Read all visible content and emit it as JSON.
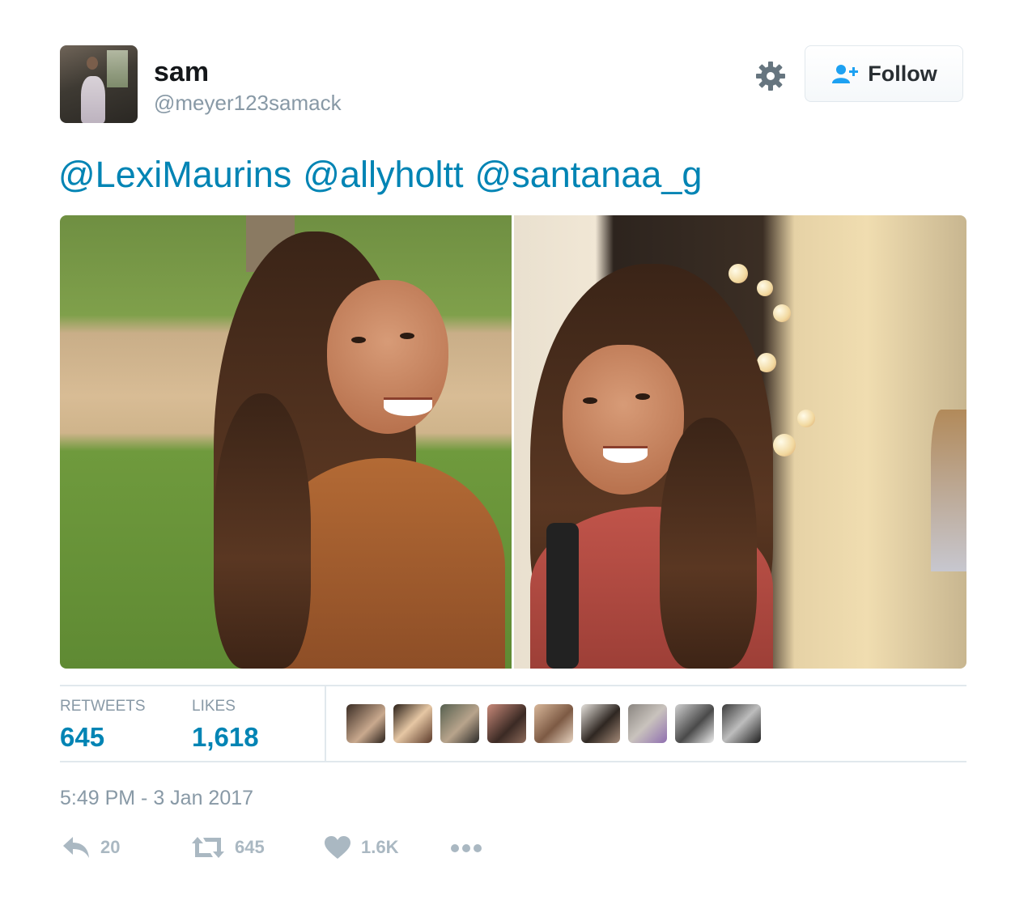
{
  "user": {
    "display_name": "sam",
    "username": "@meyer123samack"
  },
  "follow_button": {
    "label": "Follow"
  },
  "tweet": {
    "mentions": [
      "@LexiMaurins",
      "@allyholtt",
      "@santanaa_g"
    ]
  },
  "stats": {
    "retweets_label": "RETWEETS",
    "retweets_value": "645",
    "likes_label": "LIKES",
    "likes_value": "1,618"
  },
  "timestamp": "5:49 PM - 3 Jan 2017",
  "actions": {
    "reply_count": "20",
    "retweet_count": "645",
    "like_count": "1.6K"
  },
  "icons": {
    "settings": "gear-icon",
    "follow": "add-user-icon",
    "reply": "reply-icon",
    "retweet": "retweet-icon",
    "like": "heart-icon",
    "more": "more-icon"
  },
  "colors": {
    "link": "#0084b4",
    "muted": "#8899a6",
    "action": "#aab8c2",
    "border": "#e1e8ed"
  }
}
